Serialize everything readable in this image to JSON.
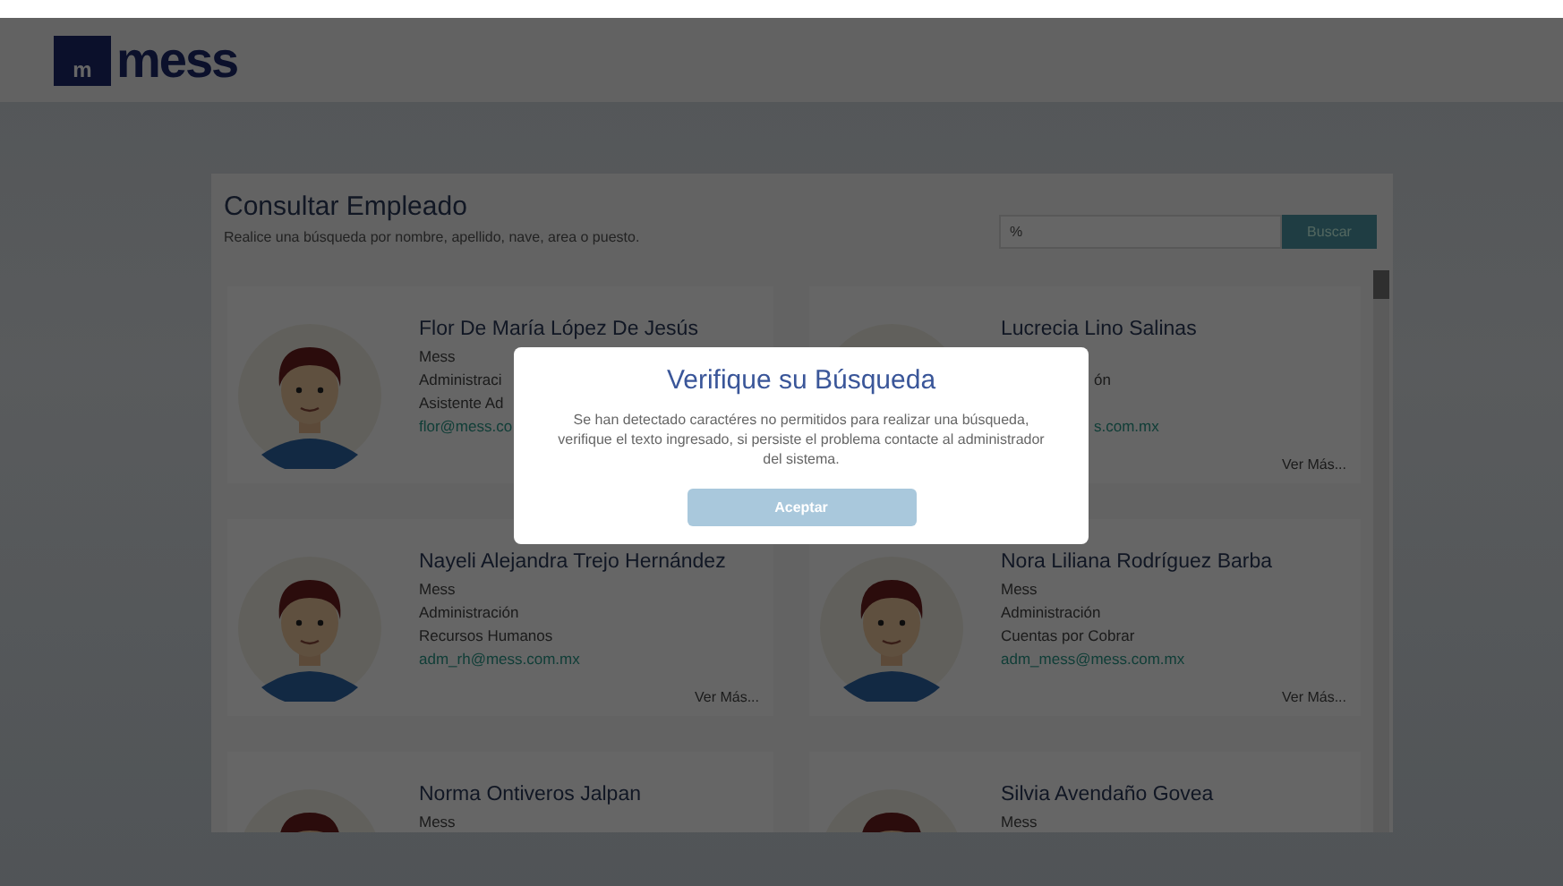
{
  "header": {
    "logo_mark": "m",
    "logo_text": "mess"
  },
  "panel": {
    "title": "Consultar Empleado",
    "subtitle": "Realice una búsqueda por nombre, apellido, nave, area o puesto.",
    "search": {
      "value": "%"
    },
    "search_button": "Buscar"
  },
  "employees": [
    {
      "name": "Flor De María López De Jesús",
      "lines": [
        {
          "kind": "plain",
          "text": "Mess"
        },
        {
          "kind": "plain",
          "text": "Administraci"
        },
        {
          "kind": "plain",
          "text": "Asistente Ad"
        },
        {
          "kind": "email",
          "text": "flor@mess.co"
        }
      ]
    },
    {
      "name": "Lucrecia Lino Salinas",
      "lines": [
        {
          "kind": "covered"
        },
        {
          "kind": "tail",
          "text": "ón"
        },
        {
          "kind": "covered"
        },
        {
          "kind": "email_tail",
          "text": "s.com.mx"
        }
      ],
      "more": "Ver Más..."
    },
    {
      "name": "Nayeli Alejandra Trejo Hernández",
      "lines": [
        {
          "kind": "plain",
          "text": "Mess"
        },
        {
          "kind": "plain",
          "text": "Administración"
        },
        {
          "kind": "plain",
          "text": "Recursos Humanos"
        },
        {
          "kind": "email",
          "text": "adm_rh@mess.com.mx"
        }
      ],
      "more": "Ver Más..."
    },
    {
      "name": "Nora Liliana Rodríguez Barba",
      "lines": [
        {
          "kind": "plain",
          "text": "Mess"
        },
        {
          "kind": "plain",
          "text": "Administración"
        },
        {
          "kind": "plain",
          "text": "Cuentas por Cobrar"
        },
        {
          "kind": "email",
          "text": "adm_mess@mess.com.mx"
        }
      ],
      "more": "Ver Más..."
    },
    {
      "name": "Norma Ontiveros Jalpan",
      "lines": [
        {
          "kind": "plain",
          "text": "Mess"
        }
      ]
    },
    {
      "name": "Silvia Avendaño Govea",
      "lines": [
        {
          "kind": "plain",
          "text": "Mess"
        }
      ]
    }
  ],
  "dialog": {
    "title": "Verifique su Búsqueda",
    "message": "Se han detectado caractéres no permitidos para realizar una búsqueda, verifique el texto ingresado, si persiste el problema contacte al administrador del sistema.",
    "button": "Aceptar"
  }
}
